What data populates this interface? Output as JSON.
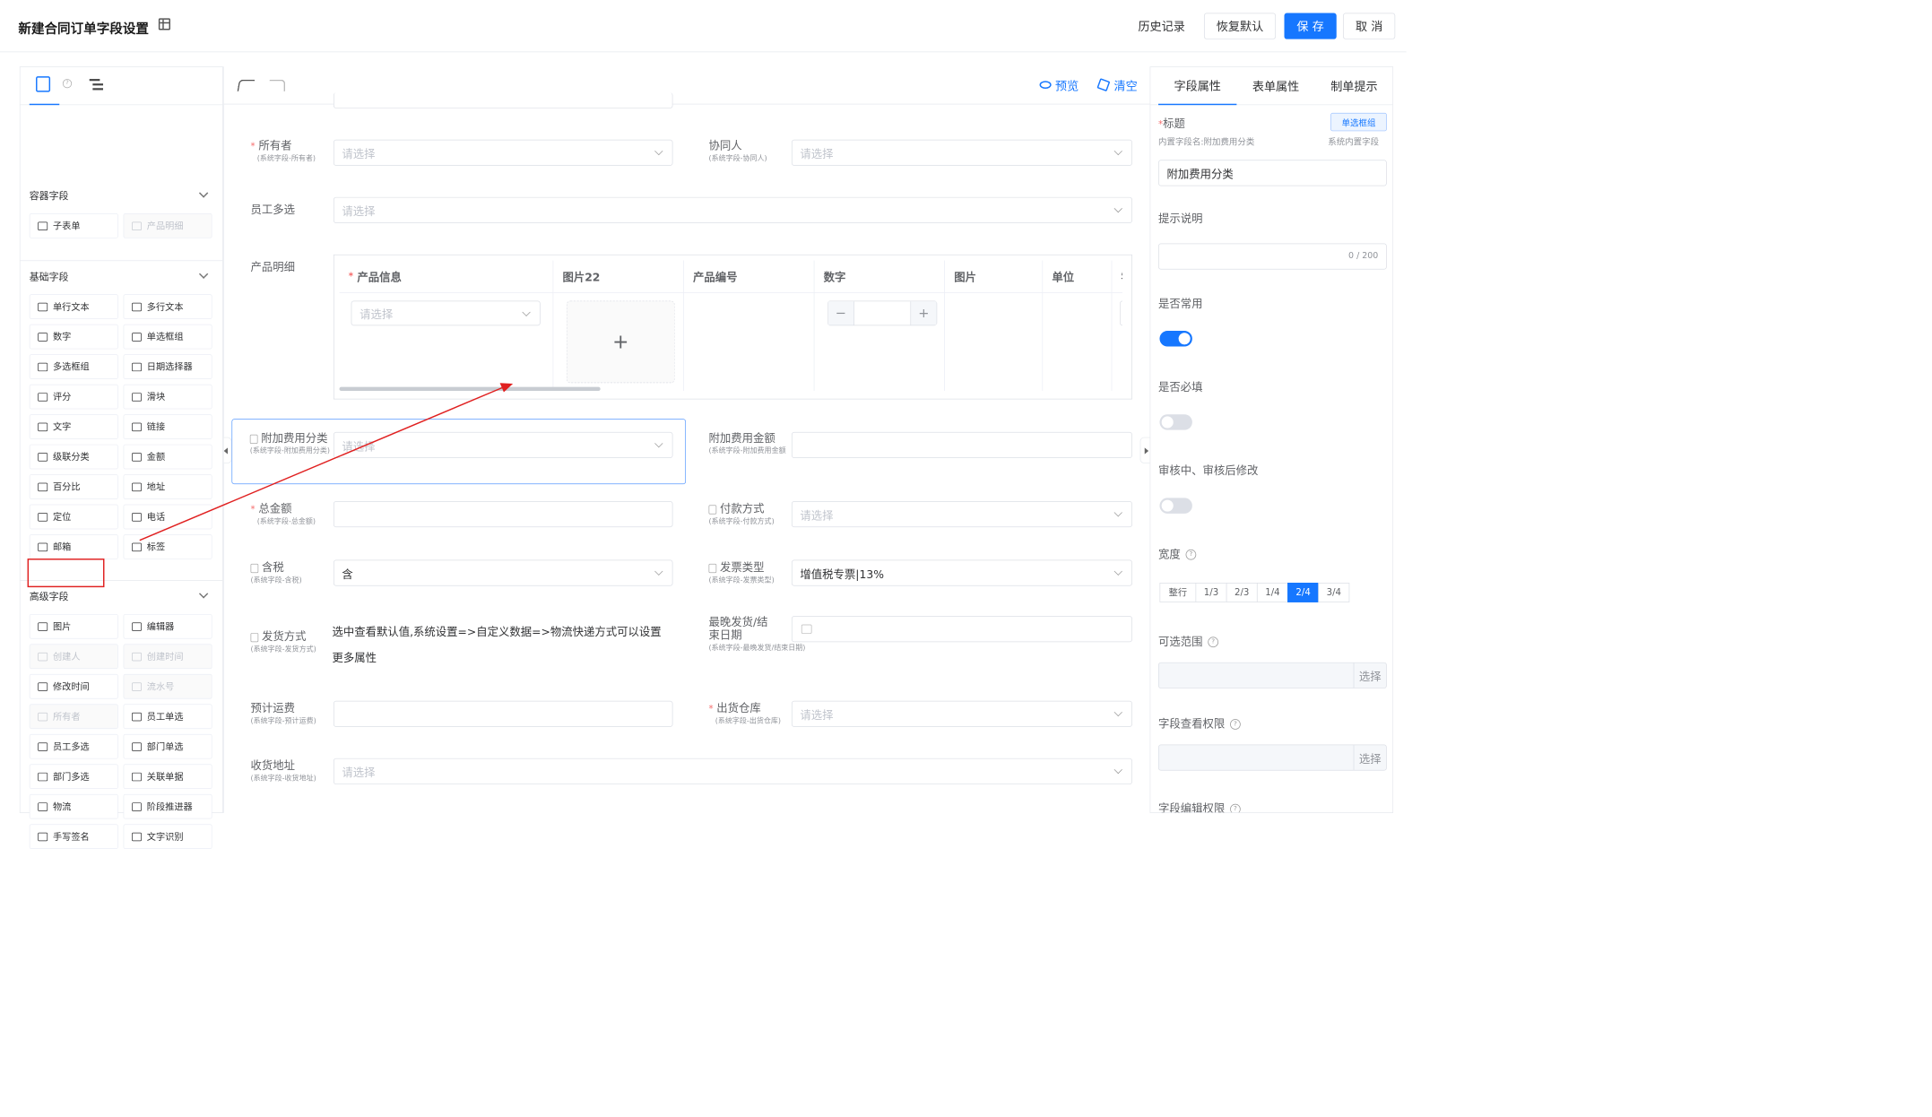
{
  "header": {
    "title": "新建合同订单字段设置",
    "history": "历史记录",
    "restore": "恢复默认",
    "save": "保 存",
    "cancel": "取 消"
  },
  "left": {
    "tab_help": "?",
    "sections": [
      {
        "title": "容器字段",
        "items": [
          {
            "label": "子表单",
            "disabled": false,
            "icon": "table-icon"
          },
          {
            "label": "产品明细",
            "disabled": true,
            "icon": "table-icon"
          }
        ]
      },
      {
        "title": "基础字段",
        "items": [
          {
            "label": "单行文本",
            "disabled": false,
            "icon": "input-icon"
          },
          {
            "label": "多行文本",
            "disabled": false,
            "icon": "textarea-icon"
          },
          {
            "label": "数字",
            "disabled": false,
            "icon": "number-icon"
          },
          {
            "label": "单选框组",
            "disabled": false,
            "icon": "radio-icon"
          },
          {
            "label": "多选框组",
            "disabled": false,
            "icon": "checkbox-icon"
          },
          {
            "label": "日期选择器",
            "disabled": false,
            "icon": "calendar-icon"
          },
          {
            "label": "评分",
            "disabled": false,
            "icon": "star-icon"
          },
          {
            "label": "滑块",
            "disabled": false,
            "icon": "slider-icon"
          },
          {
            "label": "文字",
            "disabled": false,
            "icon": "text-icon"
          },
          {
            "label": "链接",
            "disabled": false,
            "icon": "link-icon"
          },
          {
            "label": "级联分类",
            "disabled": false,
            "icon": "cascade-icon"
          },
          {
            "label": "金额",
            "disabled": false,
            "icon": "money-icon"
          },
          {
            "label": "百分比",
            "disabled": false,
            "icon": "percent-icon"
          },
          {
            "label": "地址",
            "disabled": false,
            "icon": "pin-icon"
          },
          {
            "label": "定位",
            "disabled": false,
            "icon": "location-icon"
          },
          {
            "label": "电话",
            "disabled": false,
            "icon": "phone-icon"
          },
          {
            "label": "邮箱",
            "disabled": false,
            "icon": "mail-icon"
          },
          {
            "label": "标签",
            "disabled": false,
            "icon": "tag-icon"
          }
        ]
      },
      {
        "title": "高级字段",
        "items": [
          {
            "label": "图片",
            "disabled": false,
            "icon": "image-icon"
          },
          {
            "label": "编辑器",
            "disabled": false,
            "icon": "editor-icon"
          },
          {
            "label": "创建人",
            "disabled": true,
            "icon": "user-icon"
          },
          {
            "label": "创建时间",
            "disabled": true,
            "icon": "clock-icon"
          },
          {
            "label": "修改时间",
            "disabled": false,
            "icon": "clock-icon"
          },
          {
            "label": "流水号",
            "disabled": true,
            "icon": "list-icon"
          },
          {
            "label": "所有者",
            "disabled": true,
            "icon": "clock-icon"
          },
          {
            "label": "员工单选",
            "disabled": false,
            "icon": "user-icon"
          },
          {
            "label": "员工多选",
            "disabled": false,
            "icon": "users-icon"
          },
          {
            "label": "部门单选",
            "disabled": false,
            "icon": "org-icon"
          },
          {
            "label": "部门多选",
            "disabled": false,
            "icon": "org-icon"
          },
          {
            "label": "关联单据",
            "disabled": false,
            "icon": "link-icon"
          },
          {
            "label": "物流",
            "disabled": false,
            "icon": "truck-icon"
          },
          {
            "label": "阶段推进器",
            "disabled": false,
            "icon": "stage-icon"
          },
          {
            "label": "手写签名",
            "disabled": false,
            "icon": "sign-icon"
          },
          {
            "label": "文字识别",
            "disabled": false,
            "icon": "scan-icon"
          }
        ]
      }
    ]
  },
  "center": {
    "preview": "预览",
    "clear": "清空",
    "placeholder": "请选择",
    "owner": {
      "label": "所有者",
      "sub": "(系统字段-所有者)"
    },
    "collaborator": {
      "label": "协同人",
      "sub": "(系统字段-协同人)"
    },
    "staff_multi": {
      "label": "员工多选"
    },
    "product_detail": {
      "label": "产品明细"
    },
    "table": {
      "columns": [
        "产品信息",
        "图片22",
        "产品编号",
        "数字",
        "图片",
        "单位",
        "零"
      ],
      "plus": "+",
      "minus": "−"
    },
    "extra_fee_cat": {
      "label": "附加费用分类",
      "sub": "(系统字段-附加费用分类)"
    },
    "extra_fee_amt": {
      "label": "附加费用金额",
      "sub": "(系统字段-附加费用金额"
    },
    "total": {
      "label": "总金额",
      "sub": "(系统字段-总金额)"
    },
    "payment": {
      "label": "付款方式",
      "sub": "(系统字段-付款方式)"
    },
    "tax": {
      "label": "含税",
      "sub": "(系统字段-含税)",
      "value": "含"
    },
    "invoice": {
      "label": "发票类型",
      "sub": "(系统字段-发票类型)",
      "value": "增值税专票|13%"
    },
    "ship_method": {
      "label": "发货方式",
      "sub": "(系统字段-发货方式)",
      "hint1": "选中查看默认值,系统设置=>自定义数据=>物流快递方式可以设置",
      "hint2": "更多属性"
    },
    "latest_ship": {
      "label1": "最晚发货/结",
      "label2": "束日期",
      "sub": "(系统字段-最晚发货/结束日期)"
    },
    "freight": {
      "label": "预计运费",
      "sub": "(系统字段-预计运费)"
    },
    "warehouse": {
      "label": "出货仓库",
      "sub": "(系统字段-出货仓库)"
    },
    "address": {
      "label": "收货地址",
      "sub": "(系统字段-收货地址)"
    }
  },
  "right": {
    "tabs": [
      "字段属性",
      "表单属性",
      "制单提示"
    ],
    "title_label": "标题",
    "type_badge": "单选框组",
    "inner_name": "内置字段名:附加费用分类",
    "sys_field": "系统内置字段",
    "title_value": "附加费用分类",
    "hint_label": "提示说明",
    "hint_count": "0 / 200",
    "common_label": "是否常用",
    "required_label": "是否必填",
    "audit_label": "审核中、审核后修改",
    "width_label": "宽度",
    "width_options": [
      "整行",
      "1/3",
      "2/3",
      "1/4",
      "2/4",
      "3/4"
    ],
    "width_selected": "2/4",
    "range_label": "可选范围",
    "view_perm_label": "字段查看权限",
    "edit_perm_label": "字段编辑权限",
    "choose": "选择"
  },
  "colors": {
    "primary": "#1677ff",
    "annotation": "#e02020"
  }
}
